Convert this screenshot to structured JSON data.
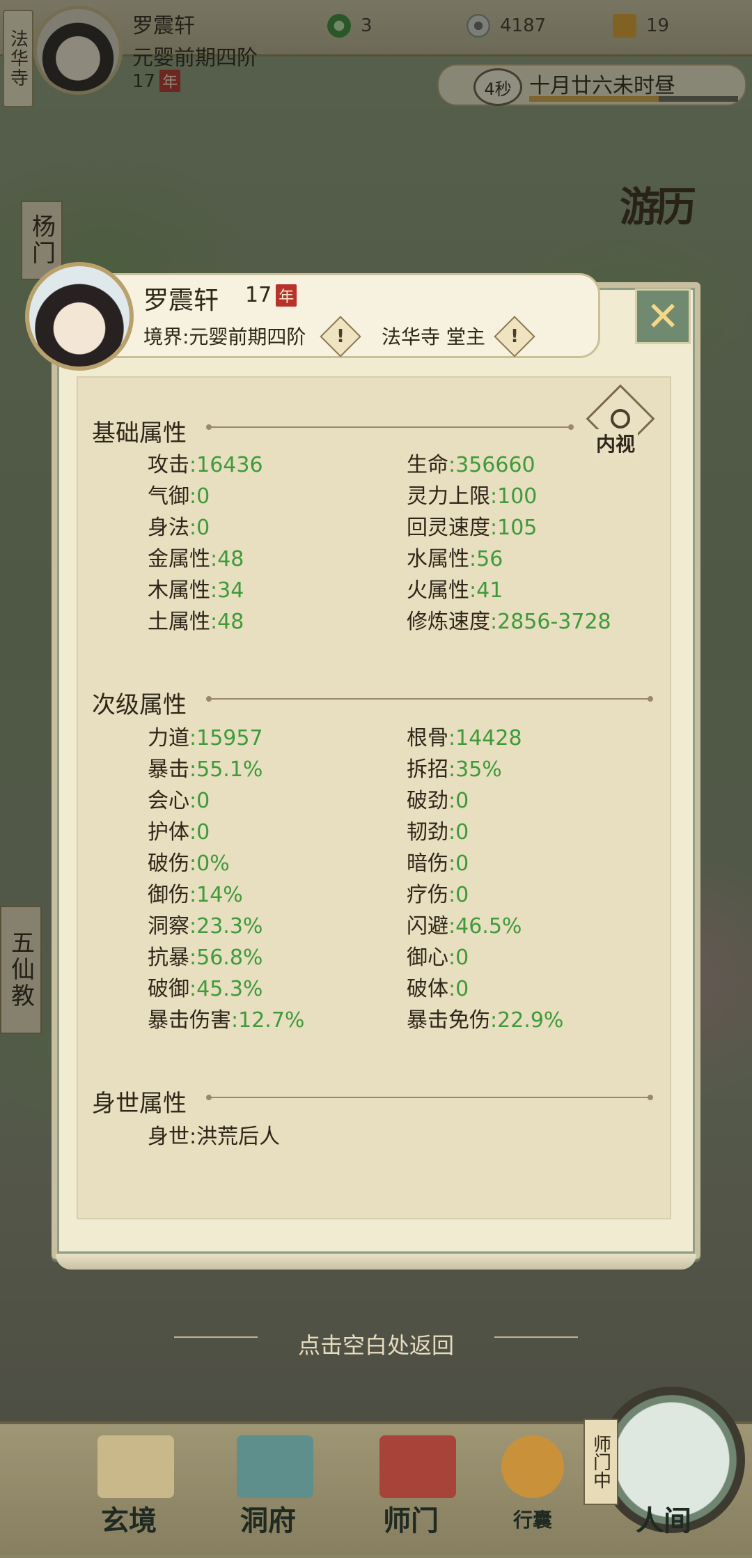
{
  "hud": {
    "sect_tag": "法华寺",
    "name": "罗震轩",
    "realm": "元婴前期四阶",
    "age": "17",
    "year_char": "年",
    "resources": [
      {
        "icon": "jade-icon",
        "value": "3"
      },
      {
        "icon": "coin-icon",
        "value": "4187"
      },
      {
        "icon": "gold-icon",
        "value": "19"
      }
    ],
    "timer_seconds": "4秒",
    "timer_text": "十月廿六未时昼",
    "timer_progress": 0.62
  },
  "map": {
    "left_sect_1": "杨门",
    "left_sect_2": "五仙教",
    "youli": "游历"
  },
  "dialog": {
    "name": "罗震轩",
    "age": "17",
    "year_char": "年",
    "realm": "境界:元婴前期四阶",
    "sect": "法华寺 堂主",
    "warn_symbol": "!",
    "close_symbol": "✕",
    "neishi": "内视",
    "basic": {
      "title": "基础属性",
      "stats": [
        {
          "label": "攻击",
          "value": ":16436"
        },
        {
          "label": "生命",
          "value": ":356660"
        },
        {
          "label": "气御",
          "value": ":0"
        },
        {
          "label": "灵力上限",
          "value": ":100"
        },
        {
          "label": "身法",
          "value": ":0"
        },
        {
          "label": "回灵速度",
          "value": ":105"
        },
        {
          "label": "金属性",
          "value": ":48"
        },
        {
          "label": "水属性",
          "value": ":56"
        },
        {
          "label": "木属性",
          "value": ":34"
        },
        {
          "label": "火属性",
          "value": ":41"
        },
        {
          "label": "土属性",
          "value": ":48"
        },
        {
          "label": "修炼速度",
          "value": ":2856-3728"
        }
      ]
    },
    "secondary": {
      "title": "次级属性",
      "stats": [
        {
          "label": "力道",
          "value": ":15957"
        },
        {
          "label": "根骨",
          "value": ":14428"
        },
        {
          "label": "暴击",
          "value": ":55.1%"
        },
        {
          "label": "拆招",
          "value": ":35%"
        },
        {
          "label": "会心",
          "value": ":0"
        },
        {
          "label": "破劲",
          "value": ":0"
        },
        {
          "label": "护体",
          "value": ":0"
        },
        {
          "label": "韧劲",
          "value": ":0"
        },
        {
          "label": "破伤",
          "value": ":0%"
        },
        {
          "label": "暗伤",
          "value": ":0"
        },
        {
          "label": "御伤",
          "value": ":14%"
        },
        {
          "label": "疗伤",
          "value": ":0"
        },
        {
          "label": "洞察",
          "value": ":23.3%"
        },
        {
          "label": "闪避",
          "value": ":46.5%"
        },
        {
          "label": "抗暴",
          "value": ":56.8%"
        },
        {
          "label": "御心",
          "value": ":0"
        },
        {
          "label": "破御",
          "value": ":45.3%"
        },
        {
          "label": "破体",
          "value": ":0"
        },
        {
          "label": "暴击伤害",
          "value": ":12.7%"
        },
        {
          "label": "暴击免伤",
          "value": ":22.9%"
        }
      ]
    },
    "background": {
      "title": "身世属性",
      "stats": [
        {
          "label": "身世",
          "value": ":洪荒后人"
        }
      ]
    }
  },
  "return_hint": "点击空白处返回",
  "bottom_nav": {
    "items": [
      "玄境",
      "洞府",
      "师门",
      "行囊",
      "人间"
    ],
    "shimen_tag": "师门中"
  },
  "colors": {
    "value_green": "#3f9a3a",
    "panel": "#e8dfc0",
    "accent_red": "#b8322b"
  }
}
